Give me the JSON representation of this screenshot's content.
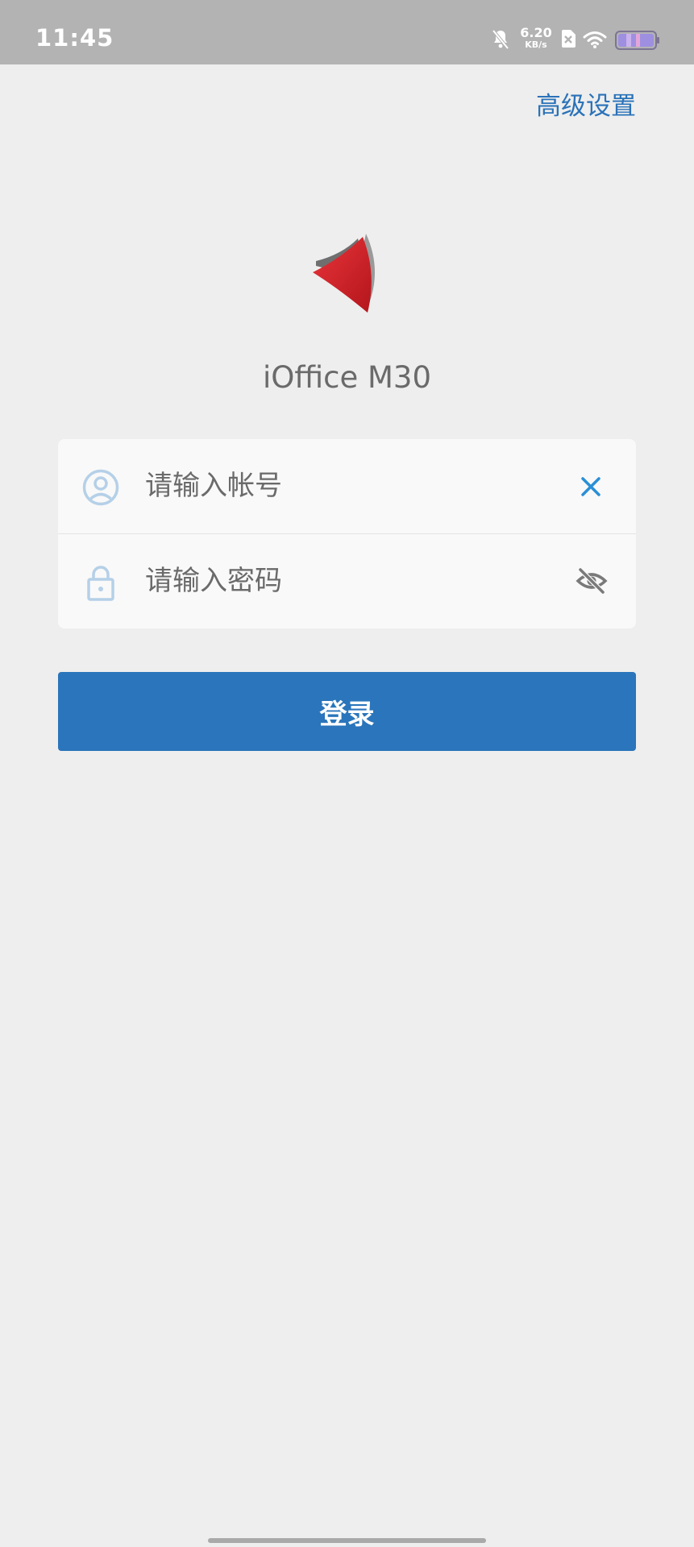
{
  "status_bar": {
    "time": "11:45",
    "network_speed_value": "6.20",
    "network_speed_unit": "KB/s",
    "icons": [
      "bell-muted-icon",
      "sim-disabled-icon",
      "wifi-icon",
      "battery-icon"
    ]
  },
  "header": {
    "advanced_settings_label": "高级设置"
  },
  "app": {
    "name": "iOffice M30",
    "logo_icon": "ioffice-logo-icon"
  },
  "login_form": {
    "username": {
      "value": "",
      "placeholder": "请输入帐号",
      "icon": "user-icon",
      "action_icon": "clear-icon"
    },
    "password": {
      "value": "",
      "placeholder": "请输入密码",
      "icon": "lock-icon",
      "action_icon": "eye-off-icon"
    },
    "submit_label": "登录"
  },
  "colors": {
    "accent": "#2a75bb",
    "status_bar": "#b3b3b3",
    "background": "#eeeeee",
    "card": "#f9f9f9",
    "field_icon": "#b5d0e8",
    "clear_icon": "#2a8fd6",
    "logo_red": "#d0252a"
  }
}
